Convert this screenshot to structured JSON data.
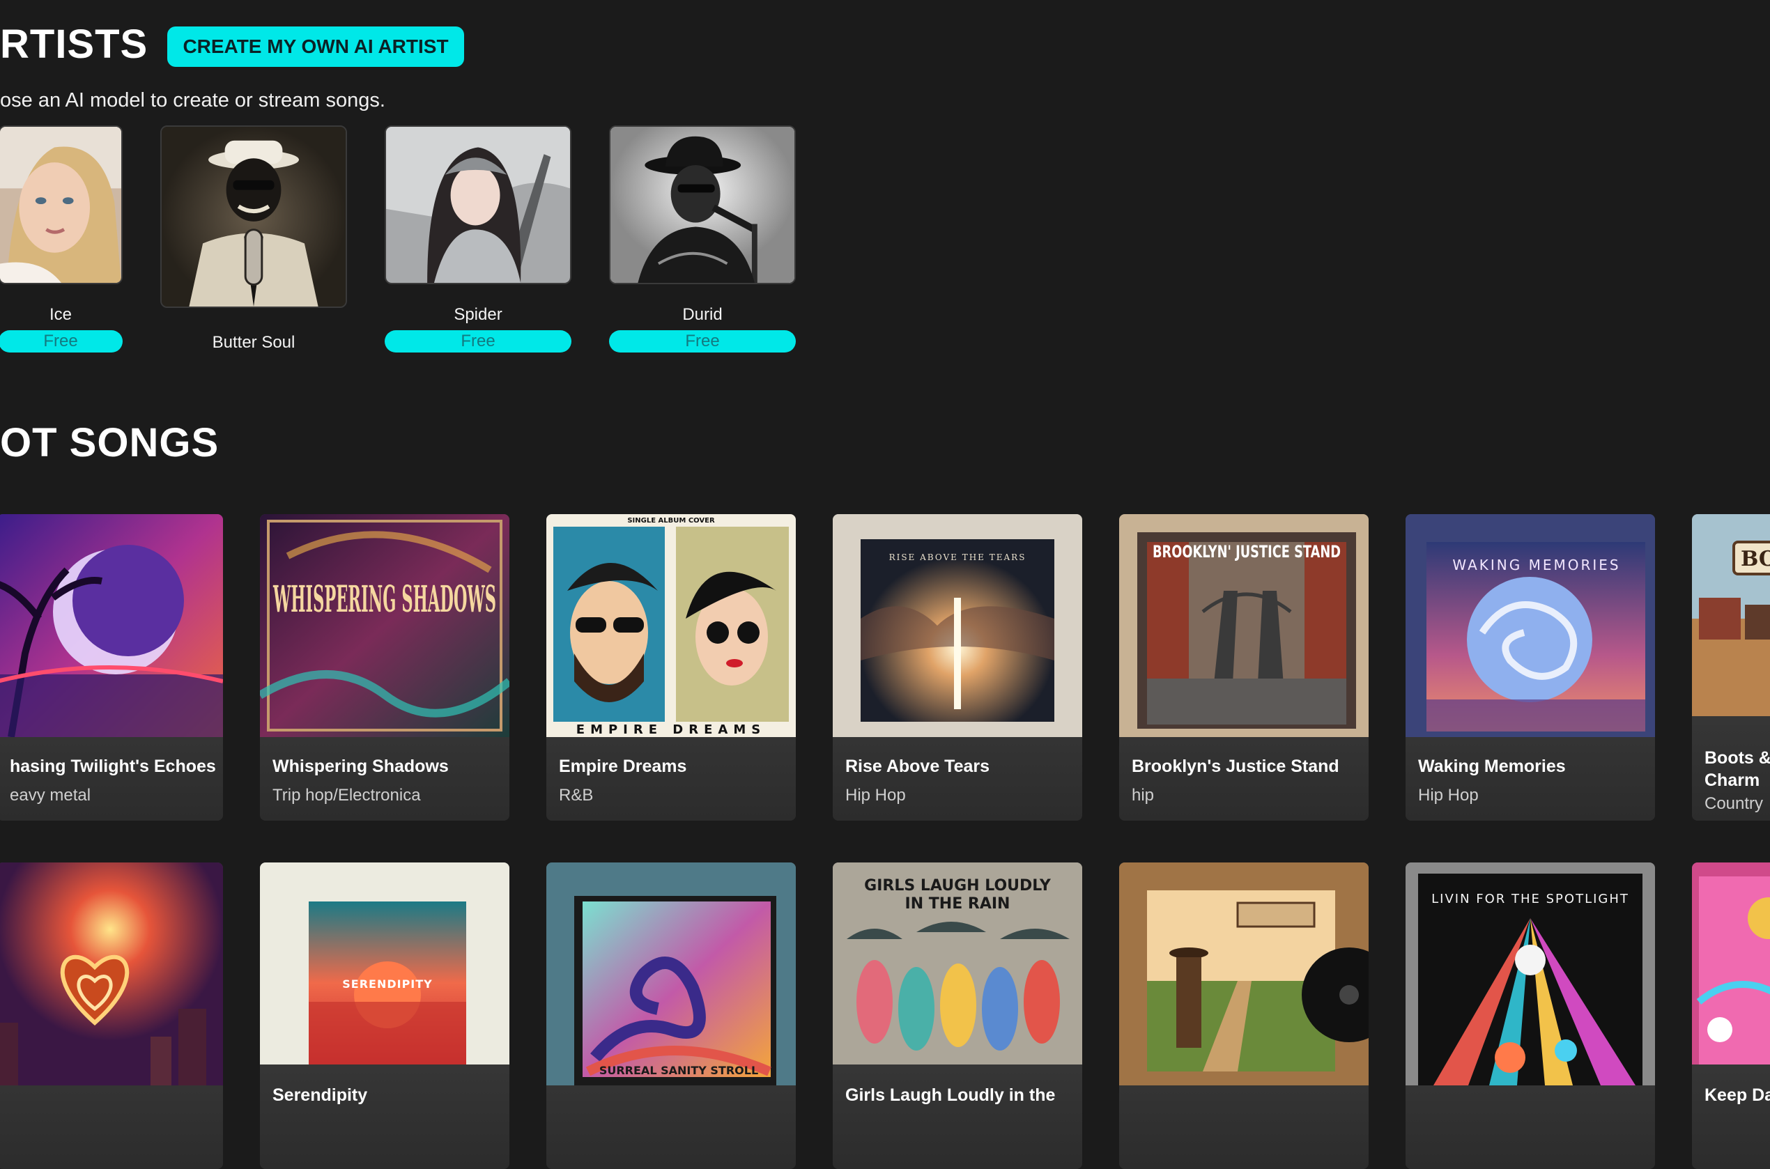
{
  "artists_section": {
    "heading": "RTISTS",
    "create_button": "CREATE MY OWN AI ARTIST",
    "subtitle": "ose an AI model to create or stream songs.",
    "items": [
      {
        "name": "Ice",
        "badge": "Free"
      },
      {
        "name": "Butter Soul",
        "badge": ""
      },
      {
        "name": "Spider",
        "badge": "Free"
      },
      {
        "name": "Durid",
        "badge": "Free"
      }
    ]
  },
  "songs_section": {
    "heading": "OT SONGS",
    "row1": [
      {
        "title": "hasing Twilight's Echoes",
        "genre": "eavy metal"
      },
      {
        "title": "Whispering Shadows",
        "genre": "Trip hop/Electronica"
      },
      {
        "title": "Empire Dreams",
        "genre": "R&B"
      },
      {
        "title": "Rise Above Tears",
        "genre": "Hip Hop"
      },
      {
        "title": "Brooklyn's Justice Stand",
        "genre": "hip"
      },
      {
        "title": "Waking Memories",
        "genre": "Hip Hop"
      },
      {
        "title": "Boots & Charm",
        "genre": "Country"
      }
    ],
    "row2": [
      {
        "title": "",
        "genre": ""
      },
      {
        "title": "Serendipity",
        "genre": ""
      },
      {
        "title": "",
        "genre": ""
      },
      {
        "title": "Girls Laugh Loudly in the",
        "genre": ""
      },
      {
        "title": "",
        "genre": ""
      },
      {
        "title": "",
        "genre": ""
      },
      {
        "title": "Keep Da",
        "genre": ""
      }
    ]
  },
  "cover_text": {
    "whispering": "WHISPERING SHADOWS",
    "empire_top": "SINGLE ALBUM COVER",
    "empire": "EMPIRE DREAMS",
    "rise": "RISE ABOVE THE TEARS",
    "brooklyn": "BROOKLYN' JUSTICE STAND",
    "waking": "WAKING MEMORIES",
    "serendipity": "SERENDIPITY",
    "surreal": "SURREAL SANITY STROLL",
    "girls_line1": "GIRLS LAUGH LOUDLY",
    "girls_line2": "IN THE RAIN",
    "spotlight": "LIVIN FOR THE SPOTLIGHT",
    "boots": "BO"
  },
  "colors": {
    "background": "#1b1b1b",
    "accent": "#00e8e8",
    "card_gradient_top": "#4a4a4a",
    "card_gradient_bottom": "#2c2c2c"
  }
}
